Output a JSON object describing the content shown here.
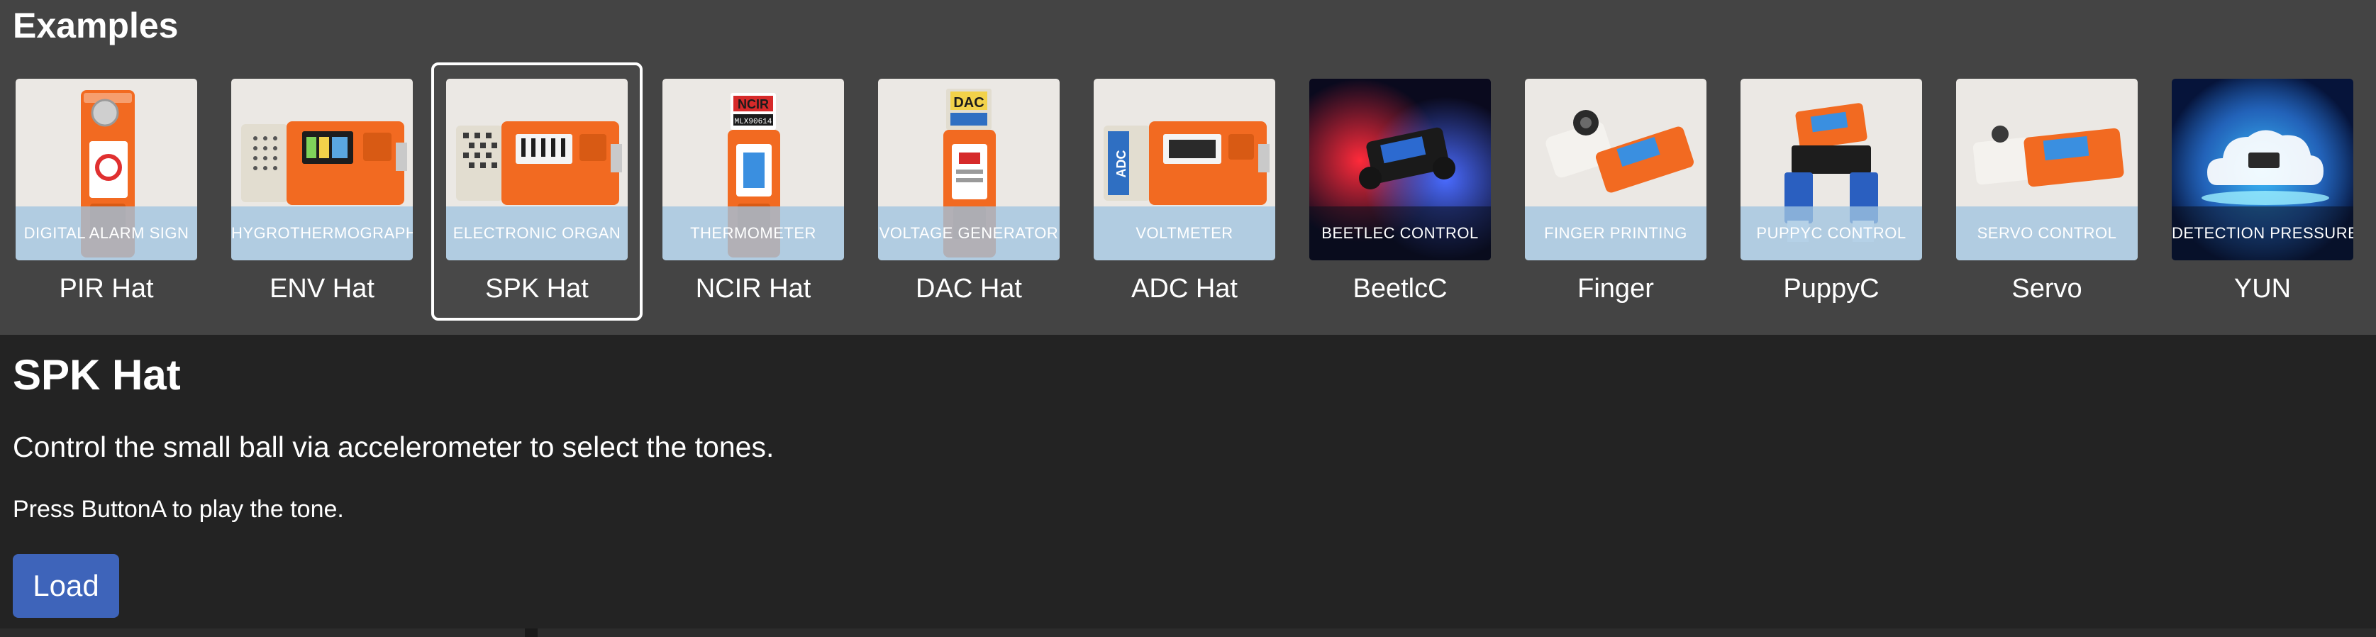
{
  "examples": {
    "title": "Examples",
    "items": [
      {
        "label": "PIR Hat",
        "caption": "DIGITAL ALARM SIGN",
        "variant": "pir"
      },
      {
        "label": "ENV Hat",
        "caption": "HYGROTHERMOGRAPH",
        "variant": "env"
      },
      {
        "label": "SPK Hat",
        "caption": "ELECTRONIC ORGAN",
        "variant": "spk"
      },
      {
        "label": "NCIR Hat",
        "caption": "THERMOMETER",
        "variant": "ncir"
      },
      {
        "label": "DAC Hat",
        "caption": "VOLTAGE GENERATOR",
        "variant": "dac"
      },
      {
        "label": "ADC Hat",
        "caption": "VOLTMETER",
        "variant": "adc"
      },
      {
        "label": "BeetlcC",
        "caption": "BEETLEC CONTROL",
        "variant": "beetlec"
      },
      {
        "label": "Finger",
        "caption": "FINGER PRINTING",
        "variant": "finger"
      },
      {
        "label": "PuppyC",
        "caption": "PUPPYC CONTROL",
        "variant": "puppyc"
      },
      {
        "label": "Servo",
        "caption": "SERVO CONTROL",
        "variant": "servo"
      },
      {
        "label": "YUN",
        "caption": "DETECTION PRESSURE",
        "variant": "yun"
      }
    ],
    "selected_index": 2
  },
  "thumb_text": {
    "ncir": "NCIR",
    "ncir_code": "MLX90614",
    "dac": "DAC",
    "adc": "ADC"
  },
  "detail": {
    "title": "SPK Hat",
    "description": "Control the small ball via accelerometer to select the tones.",
    "note": "Press ButtonA to play the tone.",
    "load_label": "Load"
  },
  "colors": {
    "accent_orange": "#f26a21",
    "load_button": "#3e64ba",
    "panel_bg": "#444444",
    "page_bg": "#232323"
  }
}
